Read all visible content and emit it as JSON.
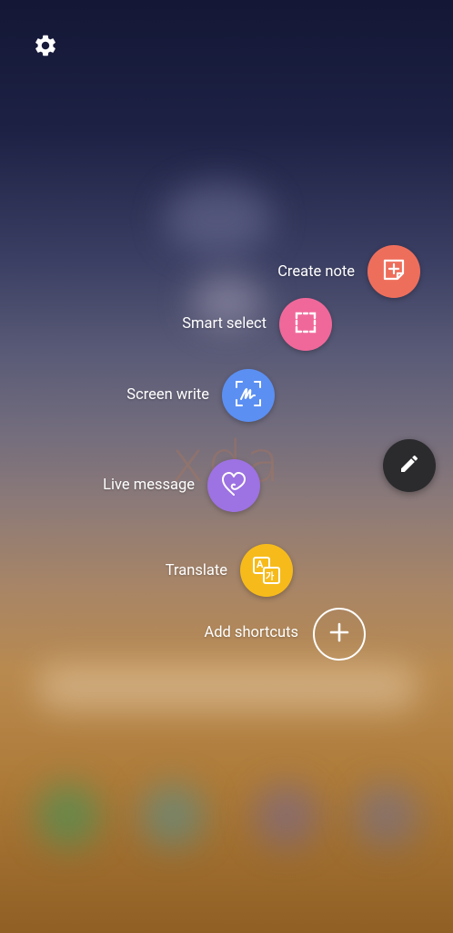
{
  "watermark": "xda",
  "actions": [
    {
      "label": "Create note",
      "icon": "create-note-icon",
      "color": "#ee6e5c"
    },
    {
      "label": "Smart select",
      "icon": "smart-select-icon",
      "color": "#f0689a"
    },
    {
      "label": "Screen write",
      "icon": "screen-write-icon",
      "color": "#5b8ff2"
    },
    {
      "label": "Live message",
      "icon": "live-message-icon",
      "color": "#9d72e2"
    },
    {
      "label": "Translate",
      "icon": "translate-icon",
      "color": "#f6bb1b"
    }
  ],
  "add_shortcuts": {
    "label": "Add shortcuts",
    "icon": "plus-icon"
  },
  "settings": {
    "icon": "gear-icon"
  },
  "air_command": {
    "icon": "pen-icon",
    "color": "#2b2b2e"
  },
  "translate_glyphs": {
    "a": "A",
    "b": "가"
  }
}
